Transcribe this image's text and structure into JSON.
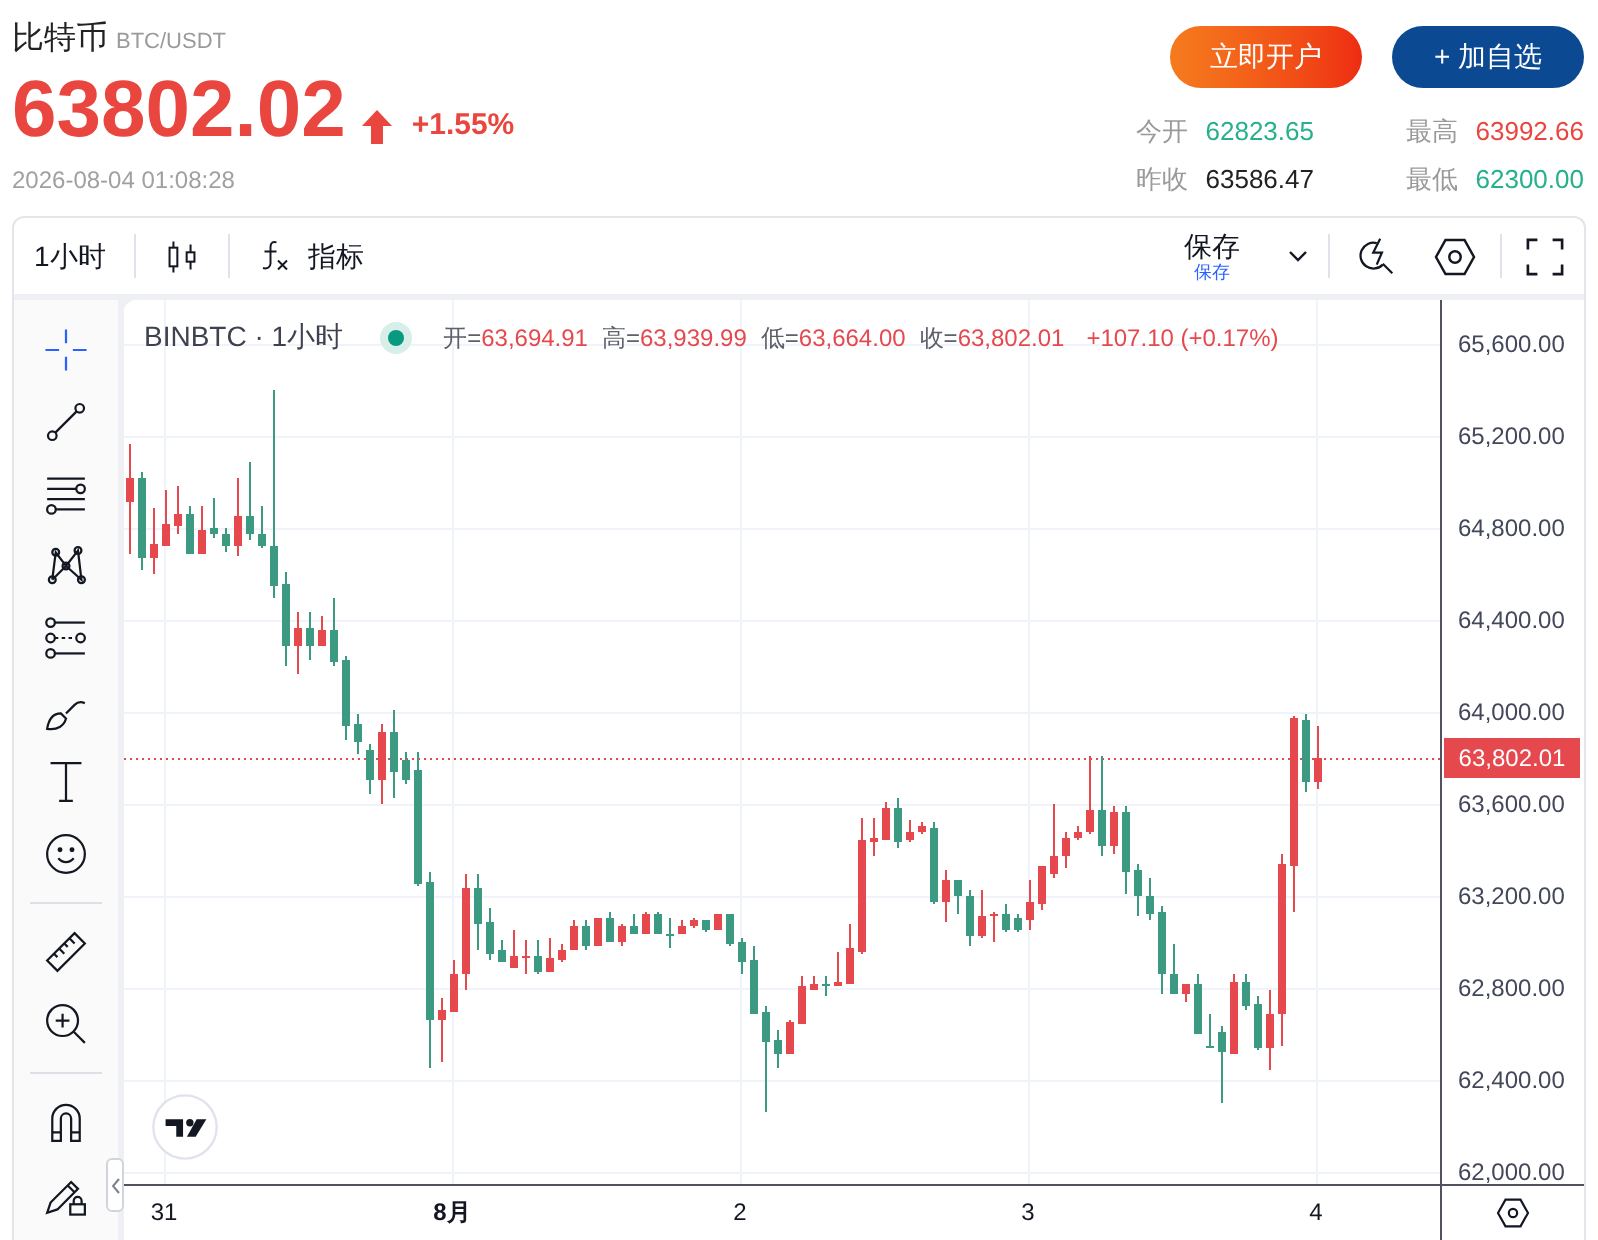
{
  "header": {
    "name": "比特币",
    "pair": "BTC/USDT",
    "price": "63802.02",
    "rising": true,
    "change": "+1.55%",
    "timestamp": "2026-08-04 01:08:28"
  },
  "actions": [
    {
      "label": "立即开户",
      "kind": "open-account"
    },
    {
      "label": "+ 加自选",
      "kind": "watchlist"
    }
  ],
  "stats": [
    {
      "label": "今开",
      "value": "62823.65",
      "color": "#26b08c"
    },
    {
      "label": "最高",
      "value": "63992.66",
      "color": "#e9463f"
    },
    {
      "label": "昨收",
      "value": "63586.47",
      "color": "#222222"
    },
    {
      "label": "最低",
      "value": "62300.00",
      "color": "#26b08c"
    }
  ],
  "toolbar": {
    "interval": "1小时",
    "indicators": "指标",
    "save": {
      "label": "保存",
      "caption": "保存"
    }
  },
  "drawing_tools": [
    [
      {
        "kind": "crosshair",
        "selected": true
      },
      {
        "kind": "trend-line",
        "selected": false
      },
      {
        "kind": "horizontal-lines",
        "selected": false
      },
      {
        "kind": "pattern",
        "selected": false
      },
      {
        "kind": "channel",
        "selected": false
      },
      {
        "kind": "brush",
        "selected": false
      },
      {
        "kind": "text",
        "selected": false
      },
      {
        "kind": "emoji",
        "selected": false
      }
    ],
    [
      {
        "kind": "ruler",
        "selected": false
      },
      {
        "kind": "zoom-in",
        "selected": false
      }
    ],
    [
      {
        "kind": "magnet",
        "selected": false
      },
      {
        "kind": "lock",
        "selected": false
      }
    ]
  ],
  "chart": {
    "symbol": "BINBTC · 1小时",
    "legend": [
      {
        "label": "开=",
        "value": "63,694.91"
      },
      {
        "label": "高=",
        "value": "63,939.99"
      },
      {
        "label": "低=",
        "value": "63,664.00"
      },
      {
        "label": "收=",
        "value": "63,802.01"
      }
    ],
    "change": "+107.10 (+0.17%)",
    "chart_data": {
      "type": "candlestick",
      "x": [
        "2026-07-30T21:00",
        "2026-07-30T22:00",
        "2026-07-30T23:00",
        "2026-07-31T00:00",
        "2026-07-31T01:00",
        "2026-07-31T02:00",
        "2026-07-31T03:00",
        "2026-07-31T04:00",
        "2026-07-31T05:00",
        "2026-07-31T06:00",
        "2026-07-31T07:00",
        "2026-07-31T08:00",
        "2026-07-31T09:00",
        "2026-07-31T10:00",
        "2026-07-31T11:00",
        "2026-07-31T12:00",
        "2026-07-31T13:00",
        "2026-07-31T14:00",
        "2026-07-31T15:00",
        "2026-07-31T16:00",
        "2026-07-31T17:00",
        "2026-07-31T18:00",
        "2026-07-31T19:00",
        "2026-07-31T20:00",
        "2026-07-31T21:00",
        "2026-07-31T22:00",
        "2026-07-31T23:00",
        "2026-08-01T00:00",
        "2026-08-01T01:00",
        "2026-08-01T02:00",
        "2026-08-01T03:00",
        "2026-08-01T04:00",
        "2026-08-01T05:00",
        "2026-08-01T06:00",
        "2026-08-01T07:00",
        "2026-08-01T08:00",
        "2026-08-01T09:00",
        "2026-08-01T10:00",
        "2026-08-01T11:00",
        "2026-08-01T12:00",
        "2026-08-01T13:00",
        "2026-08-01T14:00",
        "2026-08-01T15:00",
        "2026-08-01T16:00",
        "2026-08-01T17:00",
        "2026-08-01T18:00",
        "2026-08-01T19:00",
        "2026-08-01T20:00",
        "2026-08-01T21:00",
        "2026-08-01T22:00",
        "2026-08-01T23:00",
        "2026-08-02T00:00",
        "2026-08-02T01:00",
        "2026-08-02T02:00",
        "2026-08-02T03:00",
        "2026-08-02T04:00",
        "2026-08-02T05:00",
        "2026-08-02T06:00",
        "2026-08-02T07:00",
        "2026-08-02T08:00",
        "2026-08-02T09:00",
        "2026-08-02T10:00",
        "2026-08-02T11:00",
        "2026-08-02T12:00",
        "2026-08-02T13:00",
        "2026-08-02T14:00",
        "2026-08-02T15:00",
        "2026-08-02T16:00",
        "2026-08-02T17:00",
        "2026-08-02T18:00",
        "2026-08-02T19:00",
        "2026-08-02T20:00",
        "2026-08-02T21:00",
        "2026-08-02T22:00",
        "2026-08-02T23:00",
        "2026-08-03T00:00",
        "2026-08-03T01:00",
        "2026-08-03T02:00",
        "2026-08-03T03:00",
        "2026-08-03T04:00",
        "2026-08-03T05:00",
        "2026-08-03T06:00",
        "2026-08-03T07:00",
        "2026-08-03T08:00",
        "2026-08-03T09:00",
        "2026-08-03T10:00",
        "2026-08-03T11:00",
        "2026-08-03T12:00",
        "2026-08-03T13:00",
        "2026-08-03T14:00",
        "2026-08-03T15:00",
        "2026-08-03T16:00",
        "2026-08-03T17:00",
        "2026-08-03T18:00",
        "2026-08-03T19:00",
        "2026-08-03T20:00",
        "2026-08-03T21:00",
        "2026-08-03T22:00",
        "2026-08-03T23:00",
        "2026-08-04T00:00"
      ],
      "ohlc": [
        [
          64913,
          65165,
          64687,
          65017
        ],
        [
          65017,
          65043,
          64617,
          64670
        ],
        [
          64670,
          64887,
          64600,
          64730
        ],
        [
          64722,
          64965,
          64722,
          64817
        ],
        [
          64809,
          64983,
          64774,
          64861
        ],
        [
          64861,
          64896,
          64687,
          64687
        ],
        [
          64687,
          64896,
          64687,
          64791
        ],
        [
          64800,
          64930,
          64757,
          64774
        ],
        [
          64774,
          64800,
          64696,
          64722
        ],
        [
          64722,
          65017,
          64678,
          64852
        ],
        [
          64852,
          65087,
          64748,
          64774
        ],
        [
          64774,
          64896,
          64713,
          64722
        ],
        [
          64722,
          65400,
          64496,
          64548
        ],
        [
          64557,
          64609,
          64200,
          64287
        ],
        [
          64287,
          64435,
          64165,
          64365
        ],
        [
          64365,
          64435,
          64226,
          64287
        ],
        [
          64287,
          64417,
          64287,
          64357
        ],
        [
          64357,
          64496,
          64200,
          64217
        ],
        [
          64226,
          64243,
          63878,
          63939
        ],
        [
          63948,
          63991,
          63817,
          63870
        ],
        [
          63835,
          63861,
          63643,
          63704
        ],
        [
          63704,
          63948,
          63600,
          63913
        ],
        [
          63913,
          64009,
          63626,
          63739
        ],
        [
          63791,
          63826,
          63687,
          63704
        ],
        [
          63748,
          63826,
          63243,
          63252
        ],
        [
          63261,
          63304,
          62452,
          62661
        ],
        [
          62661,
          62757,
          62478,
          62704
        ],
        [
          62696,
          62922,
          62696,
          62861
        ],
        [
          62861,
          63296,
          62791,
          63235
        ],
        [
          63235,
          63296,
          62965,
          63078
        ],
        [
          63087,
          63148,
          62922,
          62948
        ],
        [
          62965,
          63009,
          62913,
          62913
        ],
        [
          62887,
          63052,
          62887,
          62939
        ],
        [
          62935,
          63009,
          62861,
          62939
        ],
        [
          62939,
          63009,
          62861,
          62870
        ],
        [
          62870,
          63017,
          62870,
          62930
        ],
        [
          62922,
          62991,
          62913,
          62965
        ],
        [
          62965,
          63096,
          62965,
          63070
        ],
        [
          63070,
          63096,
          62965,
          62983
        ],
        [
          62983,
          63104,
          62983,
          63104
        ],
        [
          63104,
          63130,
          63000,
          63000
        ],
        [
          63000,
          63078,
          62983,
          63070
        ],
        [
          63070,
          63122,
          63035,
          63035
        ],
        [
          63035,
          63130,
          63035,
          63122
        ],
        [
          63122,
          63130,
          63035,
          63035
        ],
        [
          63035,
          63104,
          62974,
          63030
        ],
        [
          63035,
          63096,
          63035,
          63070
        ],
        [
          63070,
          63104,
          63061,
          63096
        ],
        [
          63096,
          63096,
          63043,
          63052
        ],
        [
          63052,
          63122,
          63052,
          63122
        ],
        [
          63122,
          63122,
          62983,
          62991
        ],
        [
          63000,
          63017,
          62861,
          62913
        ],
        [
          62922,
          62983,
          62687,
          62687
        ],
        [
          62696,
          62722,
          62261,
          62565
        ],
        [
          62574,
          62617,
          62452,
          62513
        ],
        [
          62513,
          62661,
          62513,
          62652
        ],
        [
          62643,
          62852,
          62643,
          62809
        ],
        [
          62791,
          62852,
          62791,
          62817
        ],
        [
          62817,
          62852,
          62765,
          62813
        ],
        [
          62809,
          62957,
          62809,
          62826
        ],
        [
          62817,
          63078,
          62817,
          62974
        ],
        [
          62957,
          63539,
          62948,
          63443
        ],
        [
          63435,
          63539,
          63374,
          63452
        ],
        [
          63443,
          63609,
          63443,
          63583
        ],
        [
          63583,
          63626,
          63409,
          63435
        ],
        [
          63443,
          63530,
          63435,
          63478
        ],
        [
          63478,
          63522,
          63470,
          63504
        ],
        [
          63496,
          63522,
          63165,
          63174
        ],
        [
          63174,
          63313,
          63087,
          63270
        ],
        [
          63270,
          63270,
          63122,
          63200
        ],
        [
          63200,
          63226,
          62983,
          63026
        ],
        [
          63026,
          63226,
          63017,
          63113
        ],
        [
          63117,
          63130,
          63000,
          63122
        ],
        [
          63122,
          63165,
          63043,
          63052
        ],
        [
          63104,
          63122,
          63043,
          63052
        ],
        [
          63096,
          63270,
          63052,
          63174
        ],
        [
          63165,
          63330,
          63139,
          63330
        ],
        [
          63296,
          63600,
          63278,
          63374
        ],
        [
          63374,
          63478,
          63322,
          63452
        ],
        [
          63452,
          63504,
          63443,
          63478
        ],
        [
          63478,
          63809,
          63470,
          63574
        ],
        [
          63574,
          63809,
          63374,
          63417
        ],
        [
          63417,
          63591,
          63383,
          63565
        ],
        [
          63565,
          63591,
          63209,
          63304
        ],
        [
          63313,
          63339,
          63113,
          63200
        ],
        [
          63200,
          63278,
          63096,
          63122
        ],
        [
          63130,
          63157,
          62774,
          62861
        ],
        [
          62861,
          62991,
          62774,
          62774
        ],
        [
          62774,
          62817,
          62739,
          62817
        ],
        [
          62817,
          62861,
          62600,
          62600
        ],
        [
          62548,
          62687,
          62539,
          62543
        ],
        [
          62609,
          62635,
          62300,
          62522
        ],
        [
          62513,
          62861,
          62513,
          62826
        ],
        [
          62826,
          62861,
          62704,
          62722
        ],
        [
          62730,
          62765,
          62530,
          62539
        ],
        [
          62539,
          62791,
          62443,
          62687
        ],
        [
          62687,
          63383,
          62548,
          63339
        ],
        [
          63330,
          63983,
          63130,
          63974
        ],
        [
          63965,
          63992.66,
          63652,
          63695
        ],
        [
          63694.91,
          63939.99,
          63664,
          63802.01
        ]
      ],
      "xlim": [
        "2026-07-30T20:30",
        "2026-08-04T22:10"
      ],
      "ylim": [
        61947.83,
        65791.3
      ],
      "xticks": [
        {
          "value": "2026-07-31T00:00",
          "label": "31"
        },
        {
          "value": "2026-08-01T00:00",
          "label": "8月"
        },
        {
          "value": "2026-08-02T00:00",
          "label": "2"
        },
        {
          "value": "2026-08-03T00:00",
          "label": "3"
        },
        {
          "value": "2026-08-04T00:00",
          "label": "4"
        }
      ],
      "yticks": [
        {
          "value": 65600,
          "label": "65,600.00"
        },
        {
          "value": 65200,
          "label": "65,200.00"
        },
        {
          "value": 64800,
          "label": "64,800.00"
        },
        {
          "value": 64400,
          "label": "64,400.00"
        },
        {
          "value": 64000,
          "label": "64,000.00"
        },
        {
          "value": 63600,
          "label": "63,600.00"
        },
        {
          "value": 63200,
          "label": "63,200.00"
        },
        {
          "value": 62800,
          "label": "62,800.00"
        },
        {
          "value": 62400,
          "label": "62,400.00"
        },
        {
          "value": 62000,
          "label": "62,000.00"
        }
      ],
      "ref_lines": [
        {
          "axis": "y",
          "value": 63802.01,
          "label": "63,802.01"
        }
      ]
    }
  }
}
